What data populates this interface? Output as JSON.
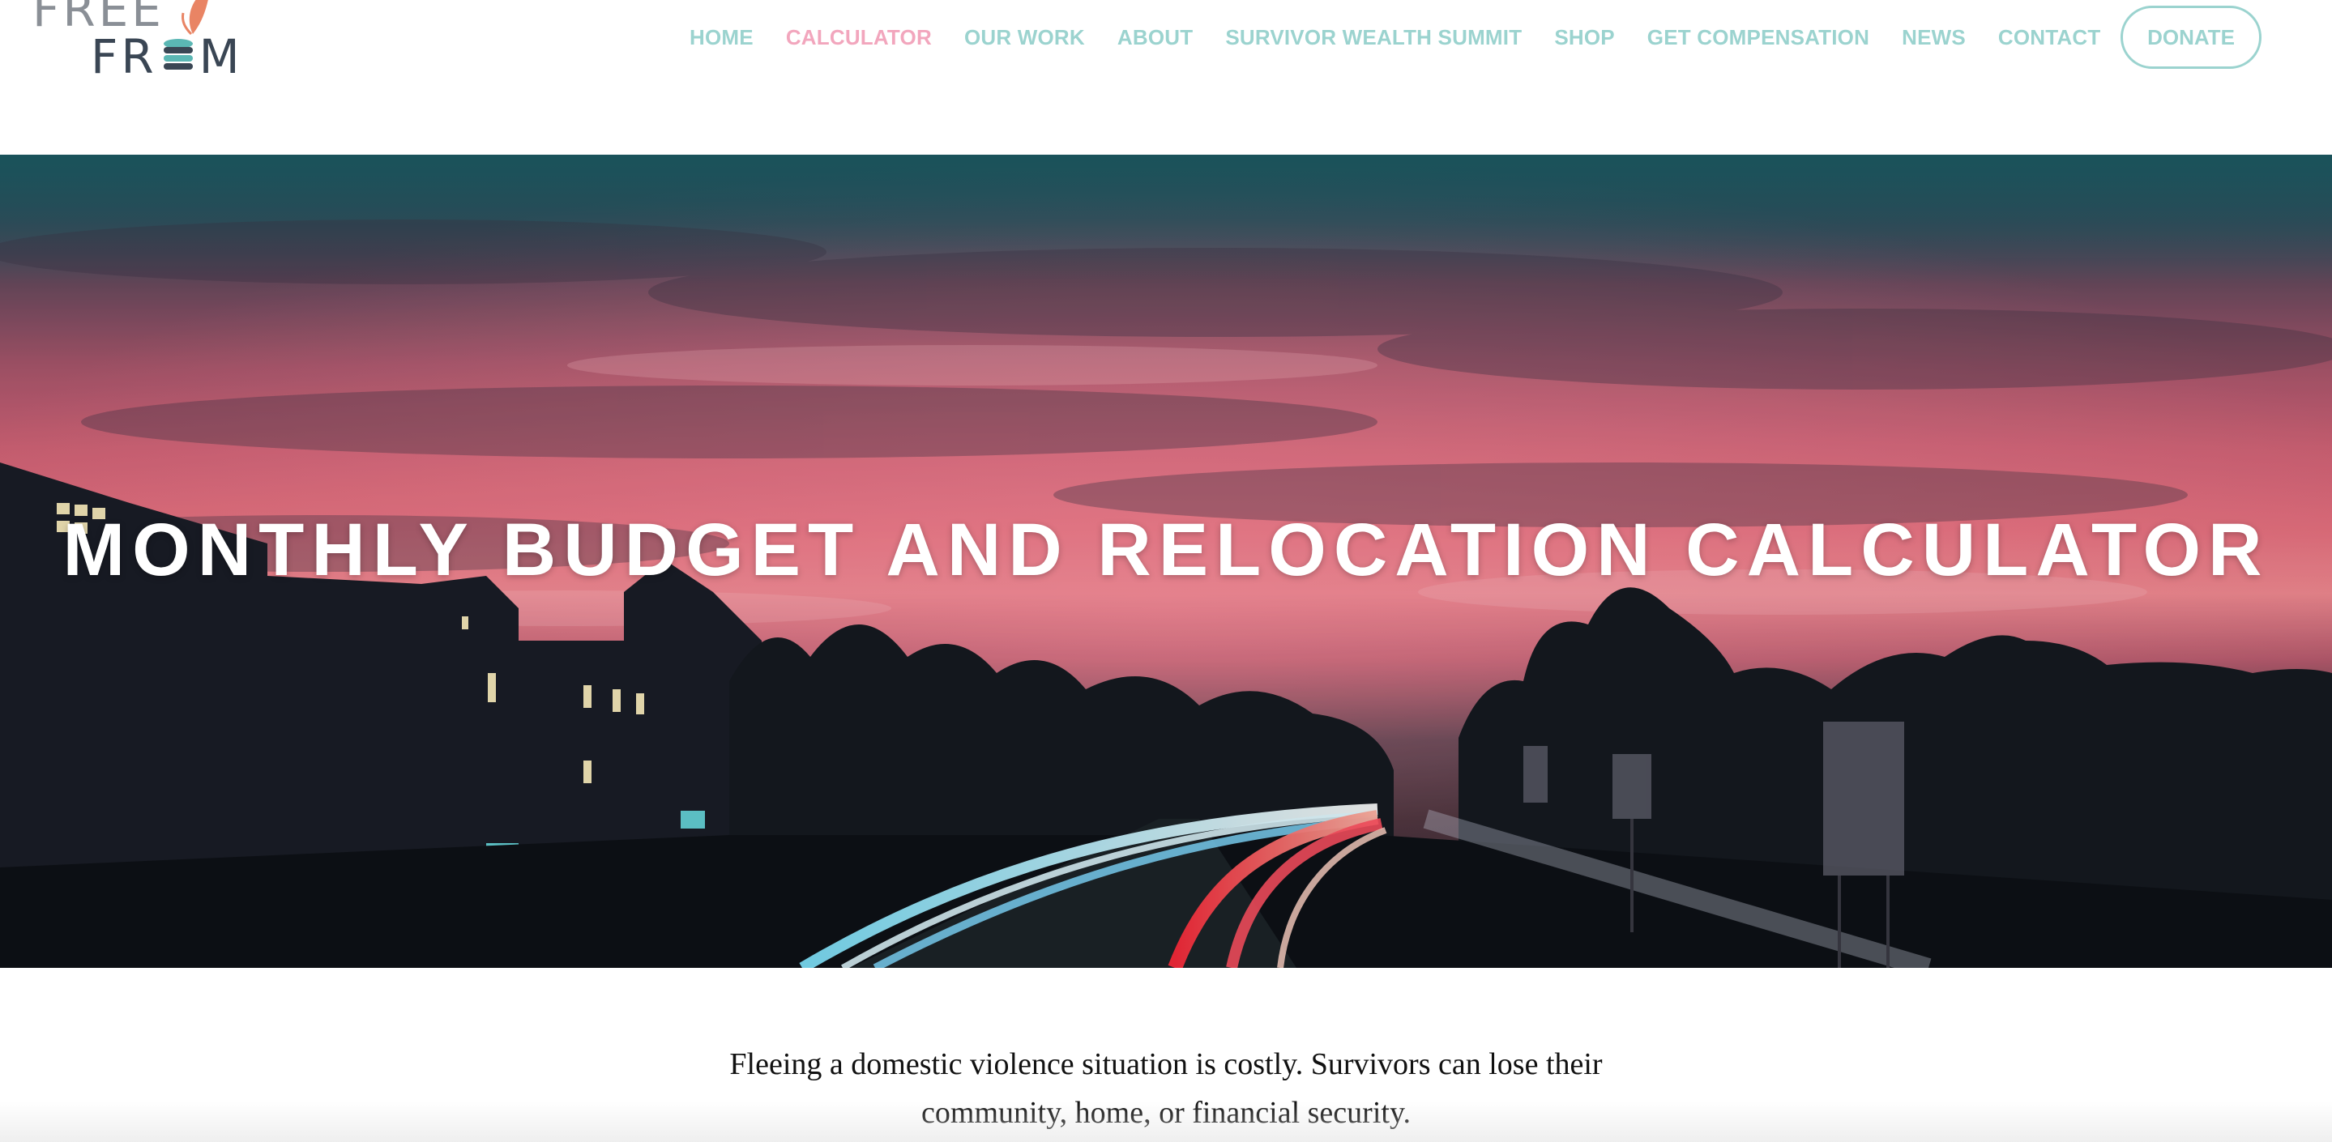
{
  "brand": {
    "logo_line1": "FREE",
    "logo_line2_left": "FR",
    "logo_line2_right": "M",
    "colors": {
      "logo_grey": "#8a8f96",
      "logo_dark": "#3a4654",
      "logo_teal": "#5bb7b4",
      "logo_coral": "#e98464"
    }
  },
  "nav": {
    "items": [
      {
        "label": "HOME"
      },
      {
        "label": "CALCULATOR",
        "active": true
      },
      {
        "label": "OUR WORK"
      },
      {
        "label": "ABOUT"
      },
      {
        "label": "SURVIVOR WEALTH SUMMIT"
      },
      {
        "label": "SHOP"
      },
      {
        "label": "GET COMPENSATION"
      },
      {
        "label": "NEWS"
      },
      {
        "label": "CONTACT"
      }
    ],
    "donate_label": "DONATE",
    "colors": {
      "link": "#9bd3cf",
      "active": "#f2a6bd"
    }
  },
  "hero": {
    "title": "MONTHLY BUDGET AND RELOCATION CALCULATOR",
    "image": "night highway with light trails under a pink sunset sky"
  },
  "intro": {
    "line1": "Fleeing a domestic violence situation is costly. Survivors can lose their",
    "line2": "community, home, or financial security."
  }
}
